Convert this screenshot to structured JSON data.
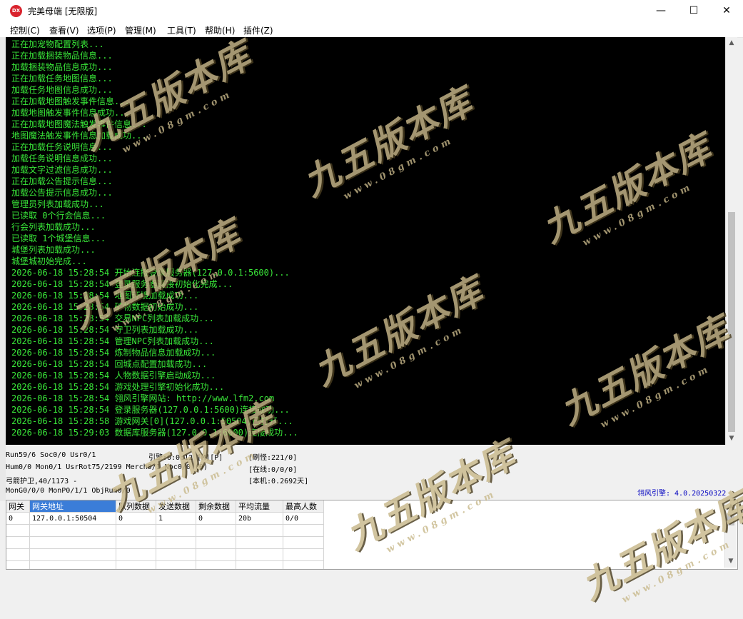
{
  "window": {
    "icon_text": "DX",
    "title": "完美母端 [无限版]",
    "minimize": "—",
    "maximize": "☐",
    "close": "✕"
  },
  "menu": [
    {
      "label": "控制(C)"
    },
    {
      "label": "查看(V)"
    },
    {
      "label": "选项(P)"
    },
    {
      "label": "管理(M)"
    },
    {
      "label": "工具(T)"
    },
    {
      "label": "帮助(H)"
    },
    {
      "label": "插件(Z)"
    }
  ],
  "console_lines": [
    "正在加宠物配置列表...",
    "正在加载捆装物品信息...",
    "加载捆装物品信息成功...",
    "正在加载任务地图信息...",
    "加载任务地图信息成功...",
    "正在加载地图触发事件信息...",
    "加载地图触发事件信息成功...",
    "正在加载地图魔法触发事件信息...",
    "地图魔法触发事件信息加载成功...",
    "正在加载任务说明信息...",
    "加载任务说明信息成功...",
    "加载文字过滤信息成功...",
    "正在加载公告提示信息...",
    "加载公告提示信息成功...",
    "管理员列表加载成功...",
    "已读取 0个行会信息...",
    "行会列表加载成功...",
    "已读取 1个城堡信息...",
    "城堡列表加载成功...",
    "城堡城初始完成...",
    "2026-06-18 15:28:54 开始连接登录服务器(127.0.0.1:5600)...",
    "2026-06-18 15:28:54 登录服务器连接初始化完成...",
    "2026-06-18 15:28:54 地图环境加载成功...",
    "2026-06-18 15:28:54 矿物数据初始成功...",
    "2026-06-18 15:28:54 交易NPC列表加载成功...",
    "2026-06-18 15:28:54 守卫列表加载成功...",
    "2026-06-18 15:28:54 管理NPC列表加载成功...",
    "2026-06-18 15:28:54 炼制物品信息加载成功...",
    "2026-06-18 15:28:54 回城点配置加载成功...",
    "2026-06-18 15:28:54 人物数据引擎启动成功...",
    "2026-06-18 15:28:54 游戏处理引擎初始化成功...",
    "2026-06-18 15:28:54 翎风引擎网站: http://www.lfm2.com",
    "2026-06-18 15:28:54 登录服务器(127.0.0.1:5600)连接成功...",
    "2026-06-18 15:28:58 游戏网关[0](127.0.0.1:50504)已打开...",
    "2026-06-18 15:29:03 数据库服务器(127.0.0.1:6000)连接成功..."
  ],
  "status": {
    "run": "Run59/6 Soc0/0 Usr0/1",
    "engine": "引擎:0:0:12 [M][P]",
    "refresh": "[刷怪:221/0]",
    "hum": "Hum0/0 Mon0/1 UsrRot75/2199 Merch0/1 Npc0/0 (0)",
    "online": "[在线:0/0/0]",
    "guard": "弓箭护卫,40/1173 -",
    "local": "[本机:0.2692天]",
    "mon": "MonG0/0/0 MonP0/1/1 ObjRun0/0",
    "version": "翎风引擎: 4.0.20250322"
  },
  "gateway_table": {
    "headers": [
      "网关",
      "网关地址",
      "队列数据",
      "发送数据",
      "剩余数据",
      "平均流量",
      "最高人数"
    ],
    "rows": [
      [
        "0",
        "127.0.0.1:50504",
        "0",
        "1",
        "0",
        "20b",
        "0/0"
      ]
    ]
  },
  "watermark": {
    "brand": "九五版本库",
    "url": "www.08gm.com"
  },
  "colors": {
    "console_text": "#39e639",
    "console_bg": "#000000",
    "version_text": "#0000c0",
    "selected_header": "#3b7dd8"
  }
}
